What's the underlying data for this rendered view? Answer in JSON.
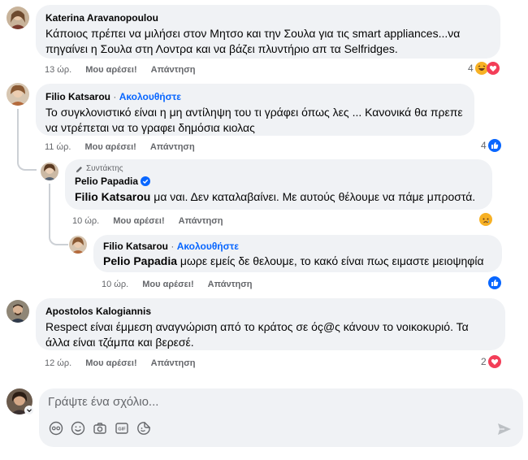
{
  "comments": [
    {
      "author": "Katerina Aravanopoulou",
      "text": "Κάποιος πρέπει να μιλήσει στον Μητσο και την Σουλα για τις smart appliances...να πηγαίνει η Σουλα στη Λοντρα και να βάζει πλυντήριο απ τα Selfridges.",
      "time": "13 ώρ.",
      "like_label": "Μου αρέσει!",
      "reply_label": "Απάντηση",
      "reaction_count": "4",
      "reactions": [
        "haha-icon",
        "love-icon"
      ]
    },
    {
      "author": "Filio Katsarou",
      "follow_label": "Ακολουθήστε",
      "text": "Το συγκλονιστικό είναι η μη αντίληψη του τι γράφει όπως λες ... Κανονικά θα πρεπε να ντρέπεται να το γραφει δημόσια κιολας",
      "time": "11 ώρ.",
      "like_label": "Μου αρέσει!",
      "reply_label": "Απάντηση",
      "reaction_count": "4",
      "reactions": [
        "like-icon"
      ]
    },
    {
      "badge": "Συντάκτης",
      "author": "Pelio Papadia",
      "mention": "Filio Katsarou",
      "text": " μα ναι. Δεν καταλαβαίνει. Με αυτούς θέλουμε να πάμε μπροστά.",
      "time": "10 ώρ.",
      "like_label": "Μου αρέσει!",
      "reply_label": "Απάντηση",
      "reactions": [
        "sad-icon"
      ]
    },
    {
      "author": "Filio Katsarou",
      "follow_label": "Ακολουθήστε",
      "mention": "Pelio Papadia",
      "text": " μωρε εμείς δε θελουμε, το κακό είναι πως ειμαστε μειοψηφία",
      "time": "10 ώρ.",
      "like_label": "Μου αρέσει!",
      "reply_label": "Απάντηση",
      "reactions": [
        "like-icon"
      ]
    },
    {
      "author": "Apostolos Kalogiannis",
      "text": "Respect είναι έμμεση αναγνώριση από το κράτος σε όç@ς κάνουν το νοικοκυριό. Τα άλλα είναι τζάμπα και βερεσέ.",
      "time": "12 ώρ.",
      "like_label": "Μου αρέσει!",
      "reply_label": "Απάντηση",
      "reaction_count": "2",
      "reactions": [
        "love-icon"
      ]
    }
  ],
  "composer": {
    "placeholder": "Γράψτε ένα σχόλιο...",
    "tools": [
      "avatar-sticker-icon",
      "emoji-icon",
      "camera-icon",
      "gif-icon",
      "sticker-icon"
    ]
  },
  "colors": {
    "bubble": "#f0f2f5",
    "link": "#0866ff",
    "like": "#0866ff",
    "love": "#f33e58",
    "haha": "#f7b125",
    "muted": "#65676b"
  }
}
